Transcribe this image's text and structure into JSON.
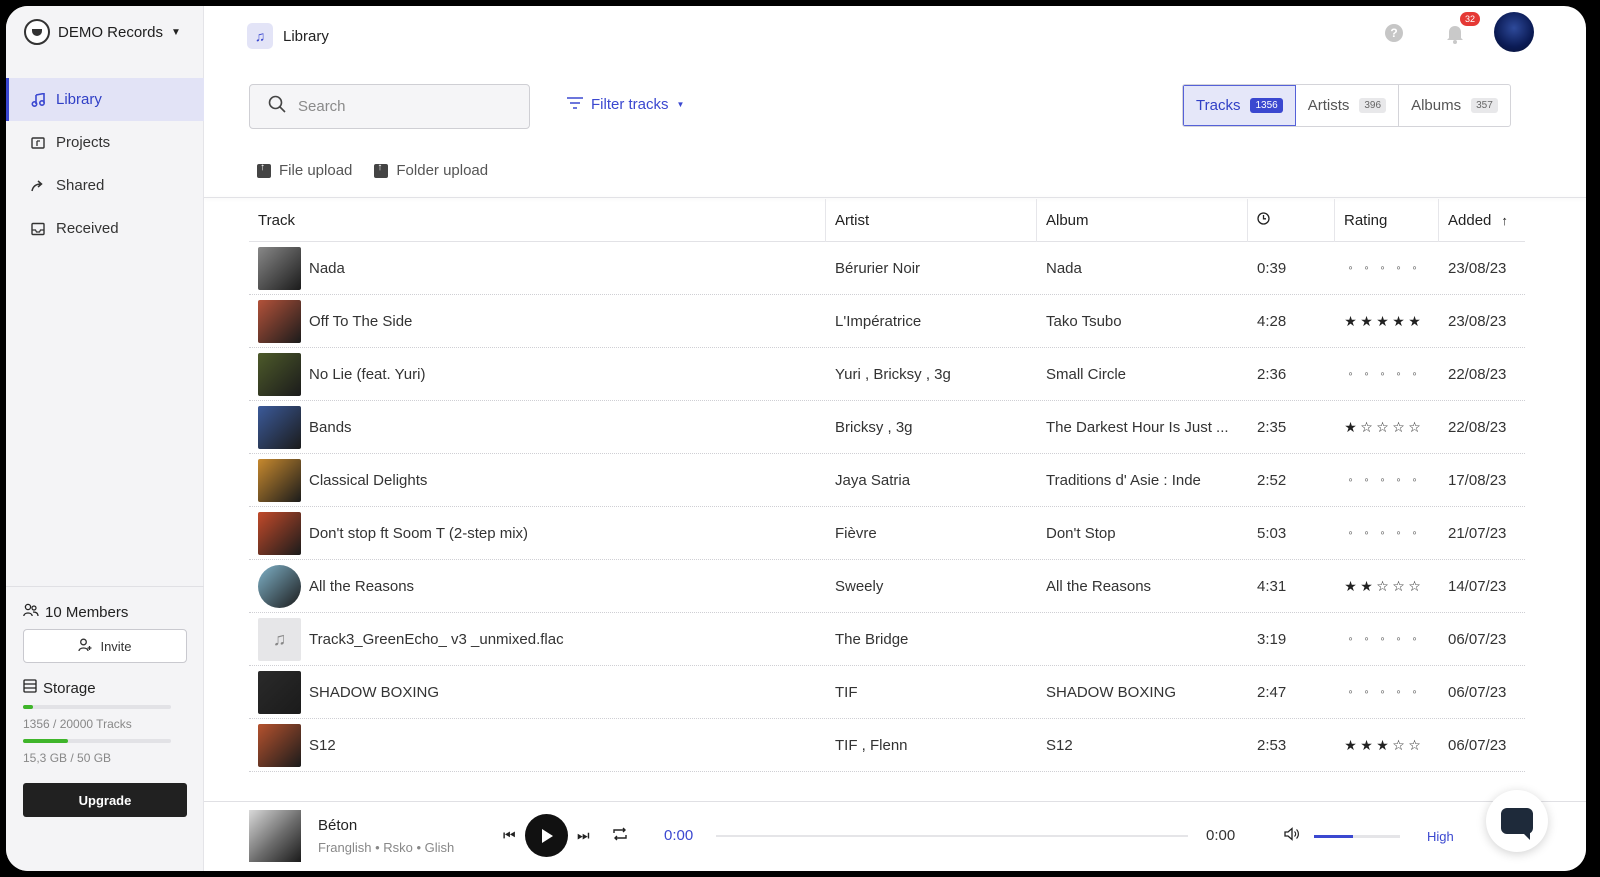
{
  "brand": {
    "name": "DEMO Records"
  },
  "sidebar": {
    "items": [
      {
        "label": "Library",
        "icon": "music-note-icon",
        "active": true
      },
      {
        "label": "Projects",
        "icon": "folder-icon"
      },
      {
        "label": "Shared",
        "icon": "share-arrow-icon"
      },
      {
        "label": "Received",
        "icon": "inbox-icon"
      }
    ],
    "members_label": "10 Members",
    "invite_label": "Invite",
    "storage_label": "Storage",
    "tracks_usage": "1356 / 20000 Tracks",
    "tracks_usage_fraction": 0.068,
    "size_usage": "15,3 GB / 50 GB",
    "size_usage_fraction": 0.306,
    "upgrade_label": "Upgrade"
  },
  "header": {
    "title": "Library",
    "notification_count": "32",
    "help_label": "?"
  },
  "toolbar": {
    "search_placeholder": "Search",
    "filter_label": "Filter tracks",
    "tabs": [
      {
        "label": "Tracks",
        "count": "1356",
        "active": true
      },
      {
        "label": "Artists",
        "count": "396"
      },
      {
        "label": "Albums",
        "count": "357"
      }
    ],
    "file_upload_label": "File upload",
    "folder_upload_label": "Folder upload"
  },
  "table": {
    "columns": {
      "track": "Track",
      "artist": "Artist",
      "album": "Album",
      "rating": "Rating",
      "added": "Added"
    },
    "rows": [
      {
        "track": "Nada",
        "artist": "Bérurier Noir",
        "album": "Nada",
        "duration": "0:39",
        "rating": 0,
        "added": "23/08/23",
        "thumb": "#888888"
      },
      {
        "track": "Off To The Side",
        "artist": "L'Impératrice",
        "album": "Tako Tsubo",
        "duration": "4:28",
        "rating": 5,
        "added": "23/08/23",
        "thumb": "#b3523a"
      },
      {
        "track": "No Lie (feat. Yuri)",
        "artist": "Yuri , Bricksy , 3g",
        "album": "Small Circle",
        "duration": "2:36",
        "rating": 0,
        "added": "22/08/23",
        "thumb": "#4d5a2a"
      },
      {
        "track": "Bands",
        "artist": "Bricksy , 3g",
        "album": "The Darkest Hour Is Just ...",
        "duration": "2:35",
        "rating": 1,
        "added": "22/08/23",
        "thumb": "#3b5a9a"
      },
      {
        "track": "Classical Delights",
        "artist": "Jaya Satria",
        "album": "Traditions d' Asie : Inde",
        "duration": "2:52",
        "rating": 0,
        "added": "17/08/23",
        "thumb": "#c7892e"
      },
      {
        "track": "Don't stop ft Soom T (2-step mix)",
        "artist": "Fièvre",
        "album": "Don't Stop",
        "duration": "5:03",
        "rating": 0,
        "added": "21/07/23",
        "thumb": "#c24a2a"
      },
      {
        "track": "All the Reasons",
        "artist": "Sweely",
        "album": "All the Reasons",
        "duration": "4:31",
        "rating": 2,
        "added": "14/07/23",
        "thumb": "#7fb2c9"
      },
      {
        "track": "Track3_GreenEcho_ v3 _unmixed.flac",
        "artist": "The Bridge",
        "album": "",
        "duration": "3:19",
        "rating": 0,
        "added": "06/07/23",
        "thumb": ""
      },
      {
        "track": "SHADOW BOXING",
        "artist": "TIF",
        "album": "SHADOW BOXING",
        "duration": "2:47",
        "rating": 0,
        "added": "06/07/23",
        "thumb": "#2a2a2a"
      },
      {
        "track": "S12",
        "artist": "TIF , Flenn",
        "album": "S12",
        "duration": "2:53",
        "rating": 3,
        "added": "06/07/23",
        "thumb": "#b5522e"
      }
    ]
  },
  "player": {
    "title": "Béton",
    "subtitle": "Franglish • Rsko • Glish",
    "current_time": "0:00",
    "total_time": "0:00",
    "quality": "High",
    "volume_fraction": 0.45
  }
}
